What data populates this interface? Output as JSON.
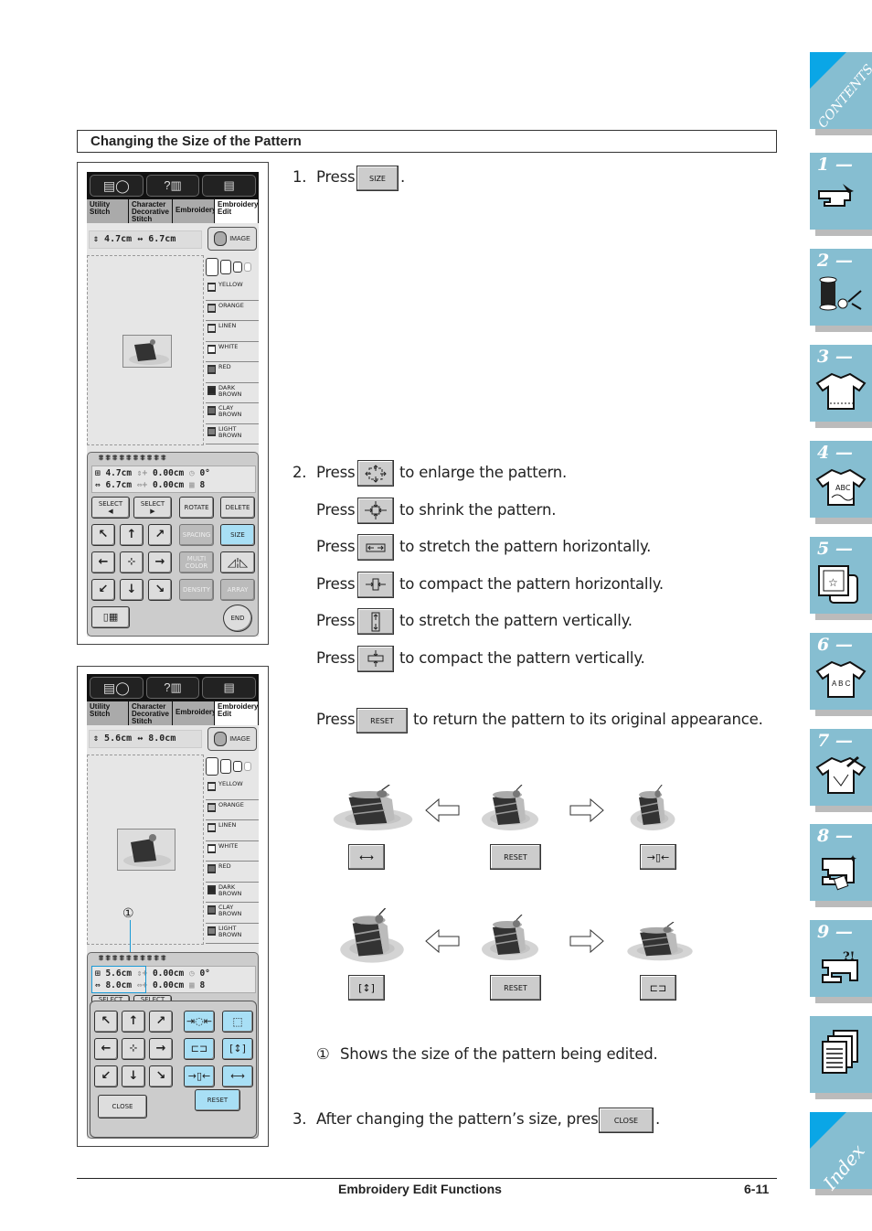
{
  "section_title": "Changing the Size of the Pattern",
  "screen1": {
    "tabs": [
      "Utility Stitch",
      "Character Decorative Stitch",
      "Embroidery",
      "Embroidery Edit"
    ],
    "active_tab": "Embroidery Edit",
    "size_height": "4.7cm",
    "size_width": "6.7cm",
    "image_button": "IMAGE",
    "colors": [
      {
        "name": "YELLOW",
        "swatch": "#e8e8e8"
      },
      {
        "name": "ORANGE",
        "swatch": "#bdbdbd"
      },
      {
        "name": "LINEN",
        "swatch": "#e0e0e0"
      },
      {
        "name": "WHITE",
        "swatch": "#fafafa"
      },
      {
        "name": "RED",
        "swatch": "#707070"
      },
      {
        "name": "DARK BROWN",
        "swatch": "#2a2a2a"
      },
      {
        "name": "CLAY BROWN",
        "swatch": "#6a6a6a"
      },
      {
        "name": "LIGHT BROWN",
        "swatch": "#7e7e7e"
      }
    ],
    "readout": {
      "height": "4.7cm",
      "width": "6.7cm",
      "offset_v": "0.00cm",
      "offset_h": "0.00cm",
      "angle": "0°",
      "color_count": "8"
    },
    "buttons": {
      "select_prev": "SELECT",
      "select_next": "SELECT",
      "rotate": "ROTATE",
      "delete": "DELETE",
      "spacing": "SPACING",
      "size": "SIZE",
      "multi_color": "MULTI COLOR",
      "density": "DENSITY",
      "array": "ARRAY",
      "end": "END"
    }
  },
  "screen2": {
    "tabs": [
      "Utility Stitch",
      "Character Decorative Stitch",
      "Embroidery",
      "Embroidery Edit"
    ],
    "size_height": "5.6cm",
    "size_width": "8.0cm",
    "image_button": "IMAGE",
    "colors": [
      {
        "name": "YELLOW",
        "swatch": "#e8e8e8"
      },
      {
        "name": "ORANGE",
        "swatch": "#bdbdbd"
      },
      {
        "name": "LINEN",
        "swatch": "#e0e0e0"
      },
      {
        "name": "WHITE",
        "swatch": "#fafafa"
      },
      {
        "name": "RED",
        "swatch": "#707070"
      },
      {
        "name": "DARK BROWN",
        "swatch": "#2a2a2a"
      },
      {
        "name": "CLAY BROWN",
        "swatch": "#6a6a6a"
      },
      {
        "name": "LIGHT BROWN",
        "swatch": "#7e7e7e"
      }
    ],
    "readout": {
      "height": "5.6cm",
      "width": "8.0cm",
      "offset_v": "0.00cm",
      "offset_h": "0.00cm",
      "angle": "0°",
      "color_count": "8"
    },
    "callout": "①",
    "buttons": {
      "select_prev": "SELECT",
      "select_next": "SELECT",
      "close": "CLOSE",
      "reset": "RESET"
    }
  },
  "steps": {
    "step1": {
      "num": "1.",
      "press": "Press",
      "button": "SIZE",
      "suffix": "."
    },
    "step2": {
      "num": "2.",
      "rows": [
        {
          "press": "Press",
          "icon": "enlarge-icon",
          "text": "to enlarge the pattern."
        },
        {
          "press": "Press",
          "icon": "shrink-icon",
          "text": "to shrink the pattern."
        },
        {
          "press": "Press",
          "icon": "stretch-horizontal-icon",
          "text": "to stretch the pattern horizontally."
        },
        {
          "press": "Press",
          "icon": "compact-horizontal-icon",
          "text": "to compact the pattern horizontally."
        },
        {
          "press": "Press",
          "icon": "stretch-vertical-icon",
          "text": "to stretch the pattern vertically."
        },
        {
          "press": "Press",
          "icon": "compact-vertical-icon",
          "text": "to compact the pattern vertically."
        }
      ],
      "reset_row": {
        "press": "Press",
        "button": "RESET",
        "text": "to return the pattern to its original appearance."
      }
    },
    "illustration": {
      "reset_label": "RESET"
    },
    "note": {
      "marker": "①",
      "text": "Shows the size of the pattern being edited."
    },
    "step3": {
      "num": "3.",
      "text": "After changing the pattern’s size, press",
      "button": "CLOSE",
      "suffix": "."
    }
  },
  "side_tabs": [
    {
      "label": "CONTENTS",
      "icon": "contents-icon"
    },
    {
      "label": "1 —",
      "icon": "sewing-machine-threading-icon"
    },
    {
      "label": "2 —",
      "icon": "thread-spool-scissors-icon"
    },
    {
      "label": "3 —",
      "icon": "shirt-hem-icon"
    },
    {
      "label": "4 —",
      "icon": "shirt-abc-icon"
    },
    {
      "label": "5 —",
      "icon": "embroidery-hoop-icon"
    },
    {
      "label": "6 —",
      "icon": "shirt-letters-icon"
    },
    {
      "label": "7 —",
      "icon": "shirt-edit-icon"
    },
    {
      "label": "8 —",
      "icon": "machine-maintenance-icon"
    },
    {
      "label": "9 —",
      "icon": "machine-troubleshoot-icon"
    },
    {
      "label": "",
      "icon": "pages-icon"
    },
    {
      "label": "Index",
      "icon": "index-icon"
    }
  ],
  "footer": {
    "title": "Embroidery Edit Functions",
    "page": "6-11"
  },
  "colors": {
    "tab_blue": "#86bed1",
    "corner_blue": "#0aa6e6",
    "lcd_highlight": "#a8dff5"
  }
}
